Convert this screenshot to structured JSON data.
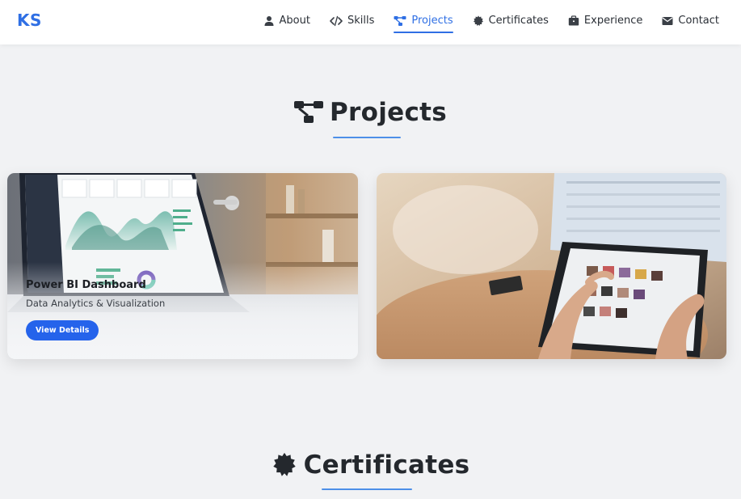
{
  "brand": "KS",
  "nav": {
    "items": [
      {
        "label": "About",
        "icon": "user-icon"
      },
      {
        "label": "Skills",
        "icon": "code-icon"
      },
      {
        "label": "Projects",
        "icon": "project-diagram-icon",
        "active": true
      },
      {
        "label": "Certificates",
        "icon": "certificate-icon"
      },
      {
        "label": "Experience",
        "icon": "briefcase-icon"
      },
      {
        "label": "Contact",
        "icon": "envelope-icon"
      }
    ]
  },
  "projects": {
    "title": "Projects",
    "cards": [
      {
        "title": "Power BI Dashboard",
        "subtitle": "Data Analytics & Visualization",
        "button": "View Details",
        "image": "laptop-dashboard-photo"
      },
      {
        "image": "tablet-browsing-photo"
      }
    ]
  },
  "certificates": {
    "title": "Certificates"
  },
  "colors": {
    "accent": "#2f6fe4",
    "button": "#2563eb",
    "background": "#f1f2f4",
    "underline": "#4d8fe8"
  }
}
